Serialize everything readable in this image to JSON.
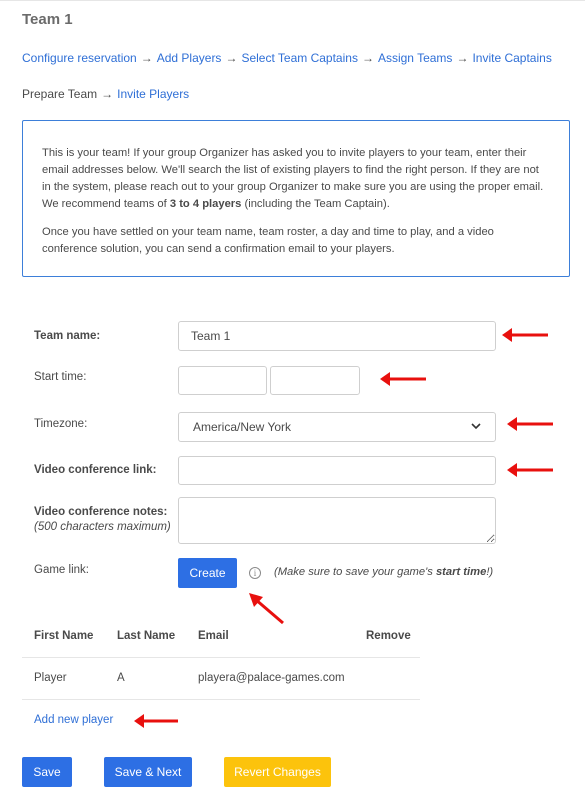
{
  "page": {
    "title": "Team 1"
  },
  "breadcrumb": {
    "row1": [
      "Configure reservation",
      "Add Players",
      "Select Team Captains",
      "Assign Teams",
      "Invite Captains"
    ],
    "row2_prefix": "Prepare Team",
    "row2_link": "Invite Players",
    "separator": "→"
  },
  "info": {
    "paragraph1_pre": "This is your team! If your group Organizer has asked you to invite players to your team, enter their email addresses below. We'll search the list of existing players to find the right person. If they are not in the system, please reach out to your group Organizer to make sure you are using the proper email. We recommend teams of ",
    "paragraph1_bold": "3 to 4 players",
    "paragraph1_post": " (including the Team Captain).",
    "paragraph2": "Once you have settled on your team name, team roster, a day and time to play, and a video conference solution, you can send a confirmation email to your players."
  },
  "form": {
    "team_name_label": "Team name:",
    "team_name_value": "Team 1",
    "start_time_label": "Start time:",
    "start_date_value": "",
    "start_time_value": "",
    "timezone_label": "Timezone:",
    "timezone_value": "America/New York",
    "video_link_label": "Video conference link:",
    "video_link_value": "",
    "video_notes_label": "Video conference notes:",
    "video_notes_sub": "(500 characters maximum)",
    "video_notes_value": "",
    "game_link_label": "Game link:",
    "create_button": "Create",
    "info_glyph": "i",
    "game_note_pre": "(Make sure to save your game's ",
    "game_note_bold": "start time",
    "game_note_post": "!)"
  },
  "table": {
    "headers": [
      "First Name",
      "Last Name",
      "Email",
      "Remove"
    ],
    "rows": [
      {
        "first_name": "Player",
        "last_name": "A",
        "email": "playera@palace-games.com"
      }
    ],
    "add_link": "Add new player"
  },
  "actions": {
    "save": "Save",
    "save_next": "Save & Next",
    "revert": "Revert Changes"
  },
  "colors": {
    "link": "#2f6fd6",
    "primary_button": "#2d6fe4",
    "revert_button": "#fcc30c",
    "annotation_arrow": "#e8100e"
  }
}
